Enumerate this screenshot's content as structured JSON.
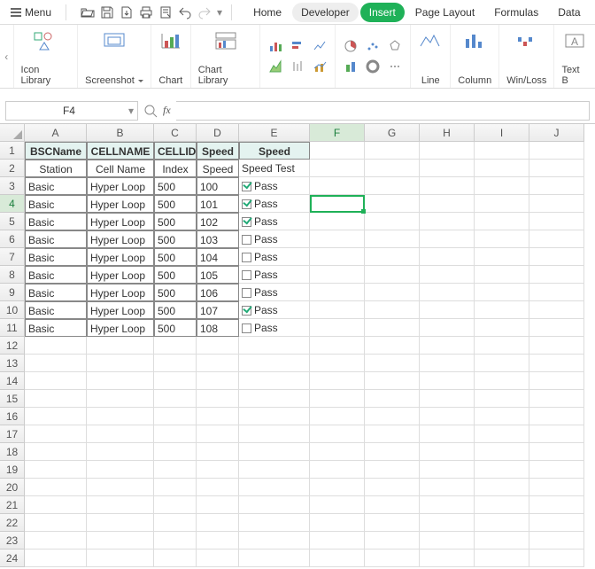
{
  "menubar": {
    "menu": "Menu"
  },
  "tabs": {
    "home": "Home",
    "developer": "Developer",
    "insert": "Insert",
    "pageLayout": "Page Layout",
    "formulas": "Formulas",
    "data": "Data"
  },
  "ribbon": {
    "iconLibrary": "Icon Library",
    "screenshot": "Screenshot",
    "chart": "Chart",
    "chartLibrary": "Chart Library",
    "line": "Line",
    "column": "Column",
    "winloss": "Win/Loss",
    "textbox": "Text B"
  },
  "formula": {
    "namebox": "F4",
    "fx": "fx",
    "value": ""
  },
  "cols": [
    "A",
    "B",
    "C",
    "D",
    "E",
    "F",
    "G",
    "H",
    "I",
    "J"
  ],
  "rows": [
    1,
    2,
    3,
    4,
    5,
    6,
    7,
    8,
    9,
    10,
    11,
    12,
    13,
    14,
    15,
    16,
    17,
    18,
    19,
    20,
    21,
    22,
    23,
    24
  ],
  "header1": {
    "a": "BSCName",
    "b": "CELLNAME",
    "c": "CELLID",
    "d": "Speed",
    "e": "Speed"
  },
  "header2": {
    "a": "Station",
    "b": "Cell Name",
    "c": "Index",
    "d": "Speed",
    "e": "Speed Test"
  },
  "data": [
    {
      "a": "Basic",
      "b": "Hyper Loop",
      "c": "500",
      "d": "100",
      "pass": true,
      "e": "Pass"
    },
    {
      "a": "Basic",
      "b": "Hyper Loop",
      "c": "500",
      "d": "101",
      "pass": true,
      "e": "Pass"
    },
    {
      "a": "Basic",
      "b": "Hyper Loop",
      "c": "500",
      "d": "102",
      "pass": true,
      "e": "Pass"
    },
    {
      "a": "Basic",
      "b": "Hyper Loop",
      "c": "500",
      "d": "103",
      "pass": false,
      "e": "Pass"
    },
    {
      "a": "Basic",
      "b": "Hyper Loop",
      "c": "500",
      "d": "104",
      "pass": false,
      "e": "Pass"
    },
    {
      "a": "Basic",
      "b": "Hyper Loop",
      "c": "500",
      "d": "105",
      "pass": false,
      "e": "Pass"
    },
    {
      "a": "Basic",
      "b": "Hyper Loop",
      "c": "500",
      "d": "106",
      "pass": false,
      "e": "Pass"
    },
    {
      "a": "Basic",
      "b": "Hyper Loop",
      "c": "500",
      "d": "107",
      "pass": true,
      "e": "Pass"
    },
    {
      "a": "Basic",
      "b": "Hyper Loop",
      "c": "500",
      "d": "108",
      "pass": false,
      "e": "Pass"
    }
  ],
  "selection": {
    "cell": "F4"
  }
}
